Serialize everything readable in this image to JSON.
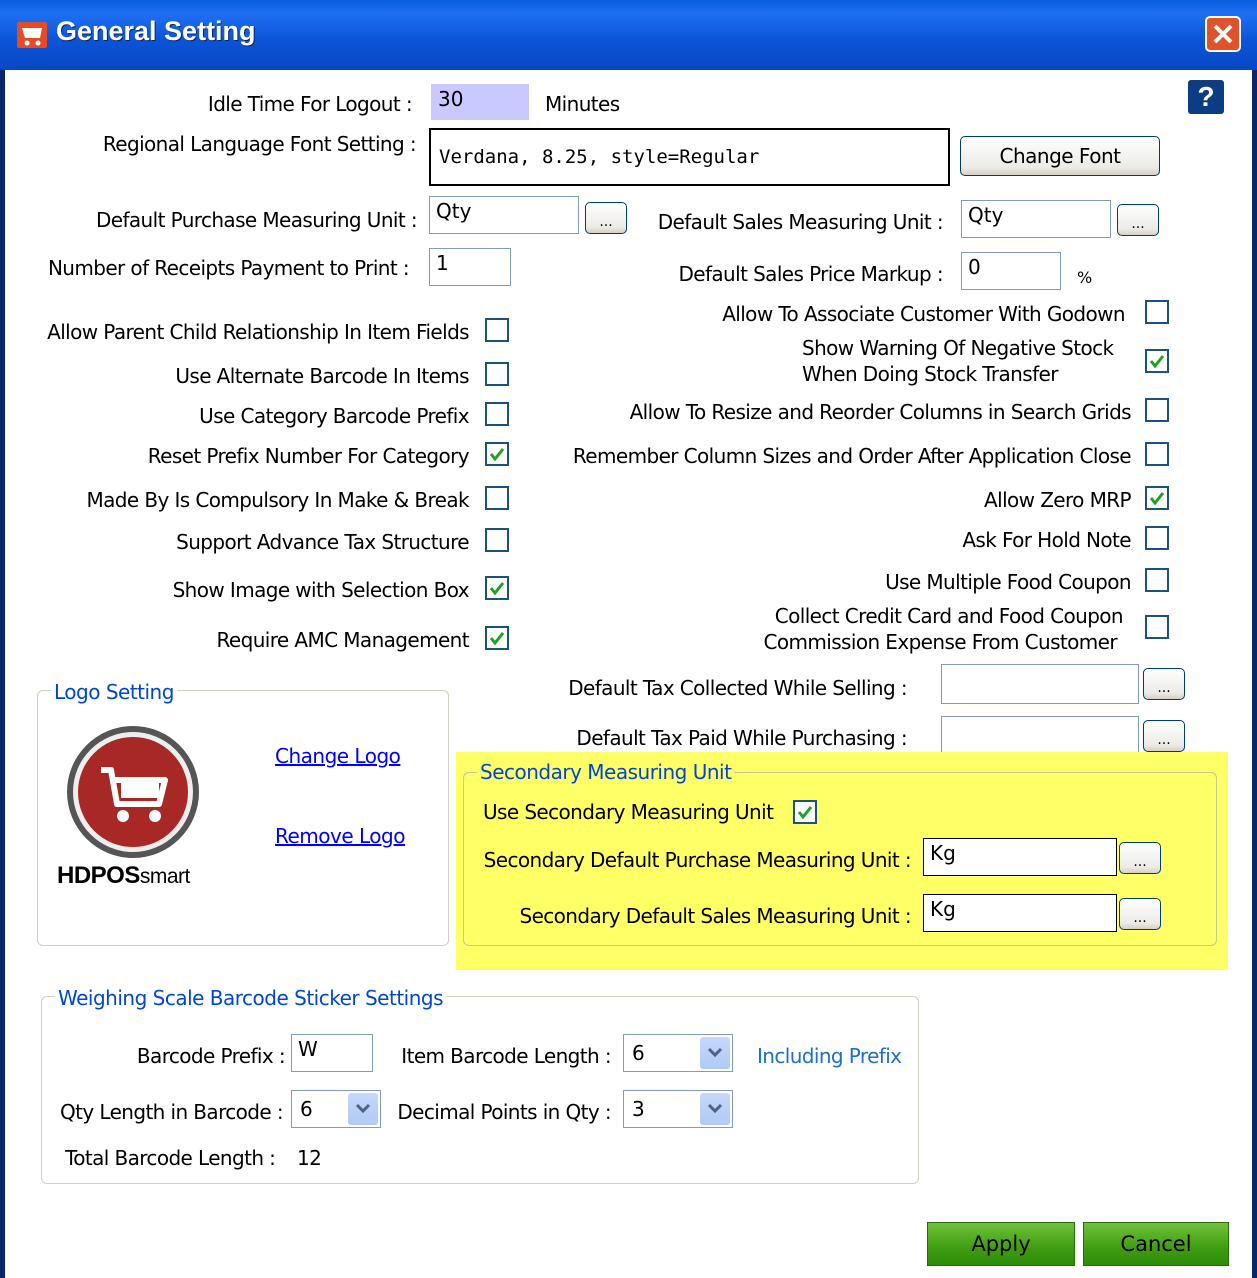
{
  "window": {
    "title": "General Setting"
  },
  "help_label": "?",
  "idle": {
    "label": "Idle Time For Logout :",
    "value": "30",
    "unit": "Minutes"
  },
  "font": {
    "label": "Regional Language Font Setting :",
    "value": "Verdana, 8.25, style=Regular",
    "button": "Change Font"
  },
  "purchase_unit": {
    "label": "Default Purchase Measuring Unit :",
    "value": "Qty"
  },
  "sales_unit": {
    "label": "Default Sales Measuring Unit :",
    "value": "Qty"
  },
  "receipts": {
    "label": "Number of Receipts Payment to Print :",
    "value": "1"
  },
  "markup": {
    "label": "Default Sales Price Markup :",
    "value": "0",
    "unit": "%"
  },
  "ellipsis": "...",
  "left_options": [
    {
      "label": "Allow Parent Child Relationship In Item Fields",
      "checked": false
    },
    {
      "label": "Use Alternate Barcode In Items",
      "checked": false
    },
    {
      "label": "Use Category Barcode Prefix",
      "checked": false
    },
    {
      "label": "Reset Prefix Number For Category",
      "checked": true
    },
    {
      "label": "Made By Is Compulsory In Make & Break",
      "checked": false
    },
    {
      "label": "Support Advance Tax Structure",
      "checked": false
    },
    {
      "label": "Show Image with Selection Box",
      "checked": true
    },
    {
      "label": "Require AMC Management",
      "checked": true
    }
  ],
  "right_options": [
    {
      "label": "Allow To Associate Customer With Godown",
      "checked": false
    },
    {
      "label": "Show Warning Of Negative Stock",
      "label2": "When Doing Stock Transfer",
      "checked": true
    },
    {
      "label": "Allow To Resize and Reorder Columns in Search Grids",
      "checked": false
    },
    {
      "label": "Remember Column Sizes and Order After Application Close",
      "checked": false
    },
    {
      "label": "Allow Zero MRP",
      "checked": true
    },
    {
      "label": "Ask For Hold Note",
      "checked": false
    },
    {
      "label": "Use Multiple Food Coupon",
      "checked": false
    },
    {
      "label": "Collect Credit Card and Food Coupon",
      "label2": "Commission Expense From Customer",
      "checked": false
    }
  ],
  "tax_collected": {
    "label": "Default Tax Collected  While Selling :",
    "value": ""
  },
  "tax_paid": {
    "label": "Default Tax Paid While Purchasing :",
    "value": ""
  },
  "logo": {
    "legend": "Logo Setting",
    "change": "Change Logo",
    "remove": "Remove Logo",
    "brand": "HDPOS",
    "brand_suffix": "smart"
  },
  "secondary": {
    "legend": "Secondary Measuring Unit",
    "use_label": "Use Secondary Measuring Unit",
    "use_checked": true,
    "purchase_label": "Secondary Default Purchase Measuring Unit :",
    "purchase_value": "Kg",
    "sales_label": "Secondary Default Sales Measuring Unit :",
    "sales_value": "Kg",
    "highlight_color": "#ffff66"
  },
  "weighing": {
    "legend": "Weighing Scale Barcode Sticker Settings",
    "prefix_label": "Barcode Prefix :",
    "prefix_value": "W",
    "item_len_label": "Item Barcode Length :",
    "item_len_value": "6",
    "including_prefix": "Including Prefix",
    "qty_len_label": "Qty Length in Barcode :",
    "qty_len_value": "6",
    "decimal_label": "Decimal Points in Qty :",
    "decimal_value": "3",
    "total_label": "Total Barcode Length :",
    "total_value": "12"
  },
  "buttons": {
    "apply": "Apply",
    "cancel": "Cancel"
  }
}
